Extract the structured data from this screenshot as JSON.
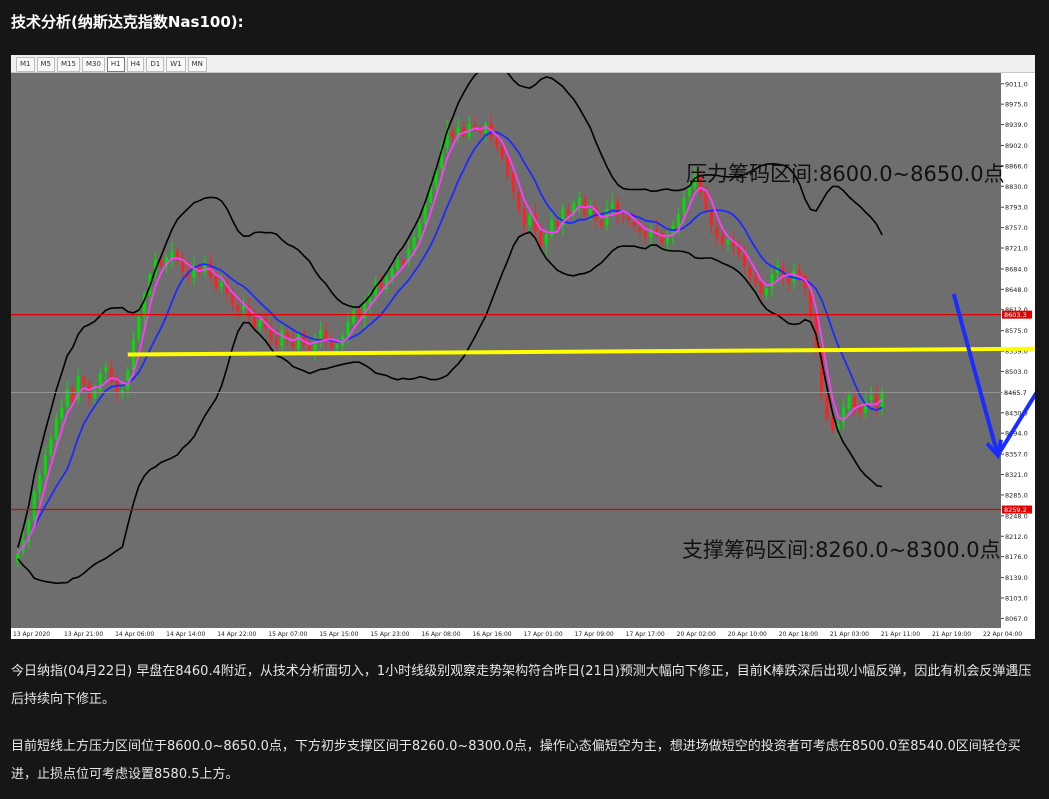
{
  "heading": "技术分析(纳斯达克指数Nas100):",
  "timeframes": [
    "M1",
    "M5",
    "M15",
    "M30",
    "H1",
    "H4",
    "D1",
    "W1",
    "MN"
  ],
  "active_timeframe": "H1",
  "annotations": {
    "resistance_label": "压力筹码区间:8600.0~8650.0点",
    "support_label": "支撑筹码区间:8260.0~8300.0点"
  },
  "paragraphs": [
    "今日纳指(04月22日) 早盘在8460.4附近，从技术分析面切入，1小时线级别观察走势架构符合昨日(21日)预测大幅向下修正，目前K棒跌深后出现小幅反弹，因此有机会反弹遇压后持续向下修正。",
    "目前短线上方压力区间位于8600.0~8650.0点，下方初步支撑区间于8260.0~8300.0点，操作心态偏短空为主，想进场做短空的投资者可考虑在8500.0至8540.0区间轻仓买进，止损点位可考虑设置8580.5上方。"
  ],
  "colors": {
    "plot_bg": "#6e6e6e",
    "bull": "#00e000",
    "bear": "#ff2020",
    "ma_fast": "#ff3cff",
    "ma_slow": "#1a2cff",
    "band": "#000000",
    "level_line": "#e00000",
    "yellow_line": "#ffff00",
    "blue_arrow": "#1a2cff",
    "green_arrow": "#2ee62e"
  },
  "chart_data": {
    "type": "candlestick",
    "ylim": [
      8050,
      9030
    ],
    "y_ticks": [
      "9011.0",
      "8975.0",
      "8939.0",
      "8902.0",
      "8866.0",
      "8830.0",
      "8793.0",
      "8757.0",
      "8721.0",
      "8684.0",
      "8648.0",
      "8612.0",
      "8575.0",
      "8539.0",
      "8503.0",
      "8466.0",
      "8430.0",
      "8394.0",
      "8357.0",
      "8321.0",
      "8285.0",
      "8248.0",
      "8212.0",
      "8176.0",
      "8139.0",
      "8103.0",
      "8067.0"
    ],
    "x_ticks": [
      "13 Apr 2020",
      "13 Apr 21:00",
      "14 Apr 06:00",
      "14 Apr 14:00",
      "14 Apr 22:00",
      "15 Apr 07:00",
      "15 Apr 15:00",
      "15 Apr 23:00",
      "16 Apr 08:00",
      "16 Apr 16:00",
      "17 Apr 01:00",
      "17 Apr 09:00",
      "17 Apr 17:00",
      "20 Apr 02:00",
      "20 Apr 10:00",
      "20 Apr 18:00",
      "21 Apr 03:00",
      "21 Apr 11:00",
      "21 Apr 19:00",
      "22 Apr 04:00"
    ],
    "current_price_label": "8465.7",
    "resistance_level_label": "8603.3",
    "support_level_label": "8259.2",
    "current_price": 8465.7,
    "resistance_level": 8603.3,
    "support_level": 8259.2,
    "yellow_line": [
      [
        0,
        8533
      ],
      [
        185,
        8543
      ]
    ],
    "blue_arrow_down": [
      [
        170,
        8640
      ],
      [
        178,
        8355
      ]
    ],
    "blue_arrow_up": [
      [
        178,
        8355
      ],
      [
        192,
        8575
      ]
    ],
    "green_circle": [
      190,
      8557
    ],
    "green_arrow": [
      [
        192,
        8560
      ],
      [
        220,
        8265
      ]
    ],
    "closes": [
      8182,
      8205,
      8240,
      8290,
      8320,
      8355,
      8385,
      8420,
      8440,
      8470,
      8450,
      8495,
      8480,
      8455,
      8470,
      8500,
      8510,
      8485,
      8465,
      8470,
      8505,
      8560,
      8600,
      8640,
      8675,
      8700,
      8690,
      8705,
      8715,
      8700,
      8680,
      8670,
      8690,
      8680,
      8695,
      8670,
      8650,
      8660,
      8640,
      8620,
      8610,
      8620,
      8600,
      8580,
      8595,
      8580,
      8560,
      8550,
      8575,
      8560,
      8545,
      8570,
      8550,
      8540,
      8560,
      8575,
      8560,
      8545,
      8550,
      8565,
      8590,
      8610,
      8600,
      8625,
      8640,
      8660,
      8650,
      8670,
      8685,
      8700,
      8695,
      8720,
      8740,
      8765,
      8800,
      8830,
      8860,
      8900,
      8930,
      8915,
      8935,
      8920,
      8940,
      8935,
      8925,
      8940,
      8915,
      8900,
      8880,
      8850,
      8820,
      8790,
      8760,
      8780,
      8750,
      8725,
      8745,
      8770,
      8760,
      8790,
      8780,
      8800,
      8810,
      8780,
      8790,
      8770,
      8760,
      8790,
      8800,
      8780,
      8775,
      8770,
      8760,
      8750,
      8740,
      8755,
      8745,
      8730,
      8740,
      8760,
      8780,
      8810,
      8830,
      8850,
      8820,
      8790,
      8760,
      8740,
      8730,
      8735,
      8725,
      8710,
      8690,
      8670,
      8660,
      8640,
      8650,
      8675,
      8690,
      8670,
      8660,
      8680,
      8670,
      8650,
      8600,
      8540,
      8460,
      8420,
      8400,
      8410,
      8440,
      8460,
      8440,
      8430,
      8450,
      8460,
      8440,
      8466
    ]
  }
}
